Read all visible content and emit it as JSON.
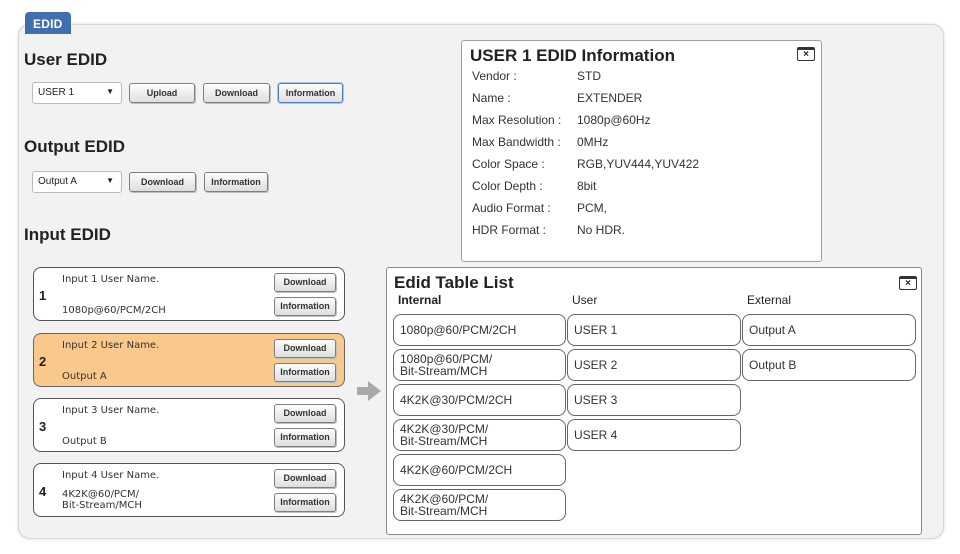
{
  "tab": {
    "label": "EDID"
  },
  "user_edid": {
    "title": "User EDID",
    "select_value": "USER 1",
    "buttons": {
      "upload": "Upload",
      "download": "Download",
      "information": "Information"
    }
  },
  "output_edid": {
    "title": "Output EDID",
    "select_value": "Output A",
    "buttons": {
      "download": "Download",
      "information": "Information"
    }
  },
  "input_edid": {
    "title": "Input EDID",
    "inputs": [
      {
        "num": "1",
        "name": "Input 1 User Name.",
        "format": "1080p@60/PCM/2CH",
        "download": "Download",
        "information": "Information"
      },
      {
        "num": "2",
        "name": "Input 2 User Name.",
        "format": "Output A",
        "download": "Download",
        "information": "Information"
      },
      {
        "num": "3",
        "name": "Input 3 User Name.",
        "format": "Output B",
        "download": "Download",
        "information": "Information"
      },
      {
        "num": "4",
        "name": "Input 4 User Name.",
        "format": "4K2K@60/PCM/\nBit-Stream/MCH",
        "download": "Download",
        "information": "Information"
      }
    ]
  },
  "info_panel": {
    "title": "USER 1 EDID Information",
    "rows": [
      {
        "key": "Vendor :",
        "value": "STD"
      },
      {
        "key": "Name :",
        "value": "EXTENDER"
      },
      {
        "key": "Max Resolution :",
        "value": "1080p@60Hz"
      },
      {
        "key": "Max Bandwidth :",
        "value": "0MHz"
      },
      {
        "key": "Color Space :",
        "value": "RGB,YUV444,YUV422"
      },
      {
        "key": "Color Depth :",
        "value": "8bit"
      },
      {
        "key": "Audio Format :",
        "value": "PCM,"
      },
      {
        "key": "HDR Format :",
        "value": "No HDR."
      }
    ]
  },
  "edid_table": {
    "title": "Edid Table List",
    "columns": {
      "internal": "Internal",
      "user": "User",
      "external": "External"
    },
    "internal": [
      "1080p@60/PCM/2CH",
      "1080p@60/PCM/\nBit-Stream/MCH",
      "4K2K@30/PCM/2CH",
      "4K2K@30/PCM/\nBit-Stream/MCH",
      "4K2K@60/PCM/2CH",
      "4K2K@60/PCM/\nBit-Stream/MCH"
    ],
    "user": [
      "USER 1",
      "USER 2",
      "USER 3",
      "USER 4"
    ],
    "external": [
      "Output A",
      "Output B"
    ]
  },
  "icons": {
    "close": "close-icon",
    "arrow": "arrow-right-icon",
    "caret": "caret-down-icon"
  },
  "colors": {
    "tab": "#3f6fae",
    "selected_input": "#f8c98a"
  }
}
